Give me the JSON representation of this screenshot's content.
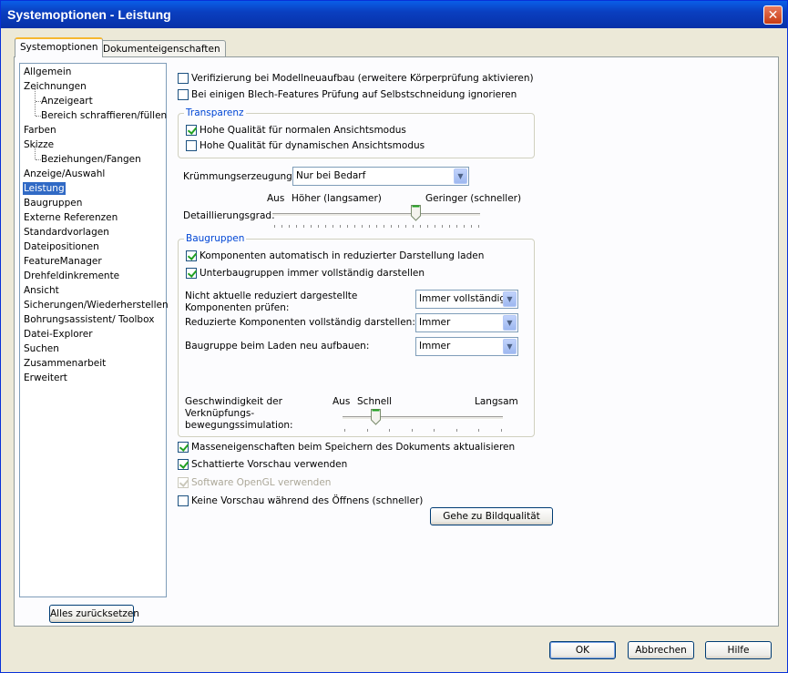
{
  "window": {
    "title": "Systemoptionen - Leistung",
    "close_glyph": "✕"
  },
  "tabs": [
    {
      "label": "Systemoptionen",
      "active": true
    },
    {
      "label": "Dokumenteigenschaften",
      "active": false
    }
  ],
  "tree": {
    "items": [
      {
        "label": "Allgemein",
        "level": 0
      },
      {
        "label": "Zeichnungen",
        "level": 0
      },
      {
        "label": "Anzeigeart",
        "level": 1
      },
      {
        "label": "Bereich schraffieren/füllen",
        "level": 1
      },
      {
        "label": "Farben",
        "level": 0
      },
      {
        "label": "Skizze",
        "level": 0
      },
      {
        "label": "Beziehungen/Fangen",
        "level": 1
      },
      {
        "label": "Anzeige/Auswahl",
        "level": 0
      },
      {
        "label": "Leistung",
        "level": 0,
        "selected": true
      },
      {
        "label": "Baugruppen",
        "level": 0
      },
      {
        "label": "Externe Referenzen",
        "level": 0
      },
      {
        "label": "Standardvorlagen",
        "level": 0
      },
      {
        "label": "Dateipositionen",
        "level": 0
      },
      {
        "label": "FeatureManager",
        "level": 0
      },
      {
        "label": "Drehfeldinkremente",
        "level": 0
      },
      {
        "label": "Ansicht",
        "level": 0
      },
      {
        "label": "Sicherungen/Wiederherstellen",
        "level": 0
      },
      {
        "label": "Bohrungsassistent/ Toolbox",
        "level": 0
      },
      {
        "label": "Datei-Explorer",
        "level": 0
      },
      {
        "label": "Suchen",
        "level": 0
      },
      {
        "label": "Zusammenarbeit",
        "level": 0
      },
      {
        "label": "Erweitert",
        "level": 0
      }
    ],
    "reset_label": "Alles zurücksetzen"
  },
  "options": {
    "verify_rebuild": {
      "label": "Verifizierung bei Modellneuaufbau (erweitere Körperprüfung aktivieren)",
      "checked": false
    },
    "sheetmetal_ignore": {
      "label": "Bei einigen Blech-Features Prüfung auf Selbstschneidung ignorieren",
      "checked": false
    },
    "transparency": {
      "title": "Transparenz",
      "normal": {
        "label": "Hohe Qualität für normalen Ansichtsmodus",
        "checked": true
      },
      "dynamic": {
        "label": "Hohe Qualität für dynamischen Ansichtsmodus",
        "checked": false
      }
    },
    "curvature": {
      "label": "Krümmungserzeugung:",
      "value": "Nur bei Bedarf"
    },
    "detail": {
      "label": "Detaillierungsgrad:",
      "off": "Aus",
      "high": "Höher (langsamer)",
      "low": "Geringer (schneller)",
      "level": 0.7
    },
    "assemblies": {
      "title": "Baugruppen",
      "auto_lightweight": {
        "label": "Komponenten automatisch in reduzierter Darstellung laden",
        "checked": true
      },
      "subassemblies": {
        "label": "Unterbaugruppen immer vollständig darstellen",
        "checked": true
      },
      "check_outdated": {
        "label_line1": "Nicht aktuelle reduziert dargestellte",
        "label_line2": "Komponenten prüfen:",
        "value": "Immer vollständig"
      },
      "resolve_lightweight": {
        "label": "Reduzierte Komponenten vollständig darstellen:",
        "value": "Immer"
      },
      "rebuild_on_load": {
        "label": "Baugruppe beim Laden neu aufbauen:",
        "value": "Immer"
      },
      "mate_speed": {
        "label_line1": "Geschwindigkeit der",
        "label_line2": "Verknüpfungs-",
        "label_line3": "bewegungssimulation:",
        "off": "Aus",
        "fast": "Schnell",
        "slow": "Langsam",
        "level": 0.19
      }
    },
    "mass_props": {
      "label": "Masseneigenschaften beim Speichern des Dokuments aktualisieren",
      "checked": true
    },
    "shaded_preview": {
      "label": "Schattierte Vorschau verwenden",
      "checked": true
    },
    "software_opengl": {
      "label": "Software OpenGL verwenden",
      "checked": true,
      "disabled": true
    },
    "no_preview": {
      "label": "Keine Vorschau während des Öffnens (schneller)",
      "checked": false
    },
    "goto_image_quality": "Gehe zu Bildqualität"
  },
  "footer": {
    "ok": "OK",
    "cancel": "Abbrechen",
    "help": "Hilfe"
  },
  "colors": {
    "titlebar": "#0a3fc0",
    "selection": "#316ac5",
    "group_title": "#0046d5"
  }
}
